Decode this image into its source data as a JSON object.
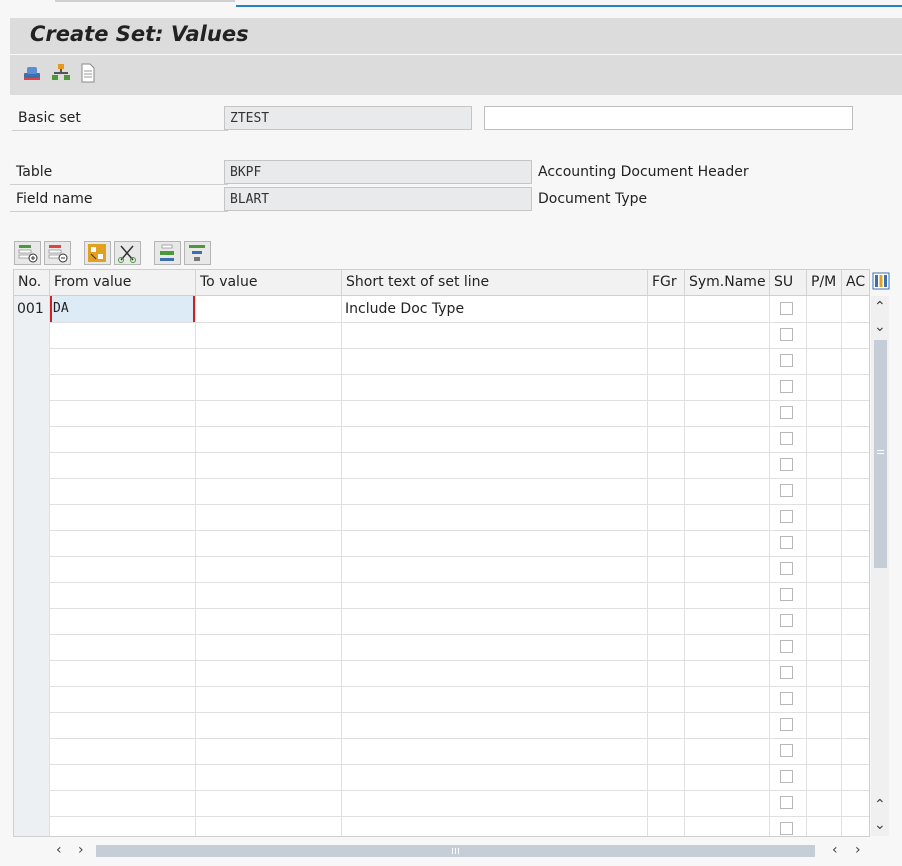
{
  "window": {
    "title": "Create Set: Values"
  },
  "toolbar": {
    "icons": [
      "header-icon",
      "hierarchy-icon",
      "document-icon"
    ]
  },
  "form": {
    "basic_set": {
      "label": "Basic set",
      "value": "ZTEST",
      "description": ""
    },
    "table": {
      "label": "Table",
      "value": "BKPF",
      "description": "Accounting Document Header"
    },
    "field_name": {
      "label": "Field name",
      "value": "BLART",
      "description": "Document Type"
    }
  },
  "table_toolbar": {
    "icons": [
      "insert-row-icon",
      "delete-row-icon",
      "select-icon",
      "cut-icon",
      "align-top-icon",
      "align-filter-icon"
    ]
  },
  "grid": {
    "columns": [
      "No.",
      "From value",
      "To value",
      "Short text of set line",
      "FGr",
      "Sym.Name",
      "SU",
      "P/M",
      "AC"
    ],
    "rows": [
      {
        "no": "001",
        "from": "DA",
        "to": "",
        "short_text": "Include Doc Type",
        "fgr": "",
        "sym_name": "",
        "su": false,
        "pm": "",
        "ac": ""
      }
    ],
    "empty_rows": 20
  },
  "colors": {
    "accent": "#2a7fc6",
    "title_bg": "#dcdcdc",
    "field_bg": "#e9eaec",
    "selected_cell": "#ddebf7",
    "focus_border": "#cc2222"
  }
}
